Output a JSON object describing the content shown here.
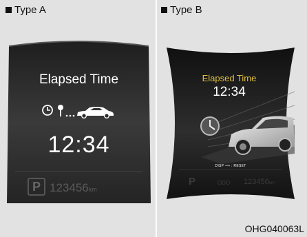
{
  "panel_a": {
    "caption": "Type A",
    "title": "Elapsed Time",
    "time": "12:34",
    "icons": [
      "clock-icon",
      "location-pin-icon",
      "car-icon"
    ],
    "parking_label": "P",
    "odometer": "123456",
    "odometer_unit": "km"
  },
  "panel_b": {
    "caption": "Type B",
    "title": "Elapsed Time",
    "time": "12:34",
    "reset_hint": "DISP ⟹ : RESET",
    "parking_label": "P",
    "odometer_label": "ODO",
    "odometer": "123456",
    "odometer_unit": "km"
  },
  "figure_ref": "OHG040063L",
  "colors": {
    "background": "#e2e2e2",
    "screen": "#2c2c2c",
    "title_b": "#e0c040"
  }
}
